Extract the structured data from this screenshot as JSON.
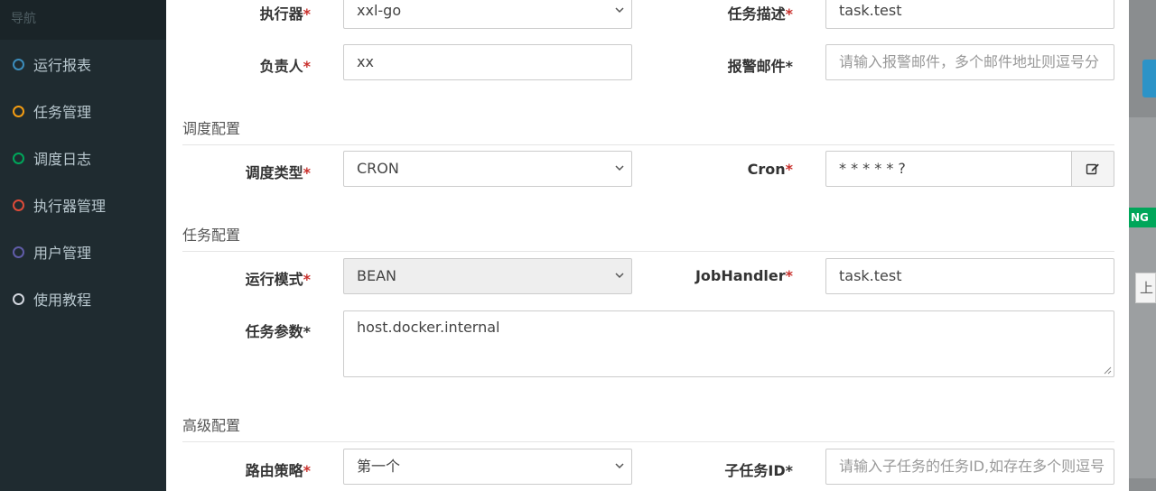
{
  "nav": {
    "header": "导航",
    "items": [
      {
        "label": "运行报表",
        "color": "#3c8dbc"
      },
      {
        "label": "任务管理",
        "color": "#f39c12"
      },
      {
        "label": "调度日志",
        "color": "#00a65a"
      },
      {
        "label": "执行器管理",
        "color": "#dd4b39"
      },
      {
        "label": "用户管理",
        "color": "#605ca8"
      },
      {
        "label": "使用教程",
        "color": "#d2d6de"
      }
    ]
  },
  "form": {
    "executor": {
      "label": "执行器",
      "value": "xxl-go"
    },
    "job_desc": {
      "label": "任务描述",
      "value": "task.test"
    },
    "owner": {
      "label": "负责人",
      "value": "xx"
    },
    "alarm_email": {
      "label": "报警邮件",
      "placeholder": "请输入报警邮件，多个邮件地址则逗号分"
    },
    "schedule_section": "调度配置",
    "schedule_type": {
      "label": "调度类型",
      "value": "CRON"
    },
    "cron": {
      "label": "Cron",
      "value": "* * * * * ?"
    },
    "task_section": "任务配置",
    "run_mode": {
      "label": "运行模式",
      "value": "BEAN"
    },
    "job_handler": {
      "label": "JobHandler",
      "value": "task.test"
    },
    "params": {
      "label": "任务参数",
      "value": "host.docker.internal"
    },
    "advanced_section": "高级配置",
    "route_strategy": {
      "label": "路由策略",
      "value": "第一个"
    },
    "child_job": {
      "label": "子任务ID",
      "placeholder": "请输入子任务的任务ID,如存在多个则逗号"
    }
  },
  "background": {
    "badge": "NG",
    "button": "上"
  },
  "required_mark": "*"
}
